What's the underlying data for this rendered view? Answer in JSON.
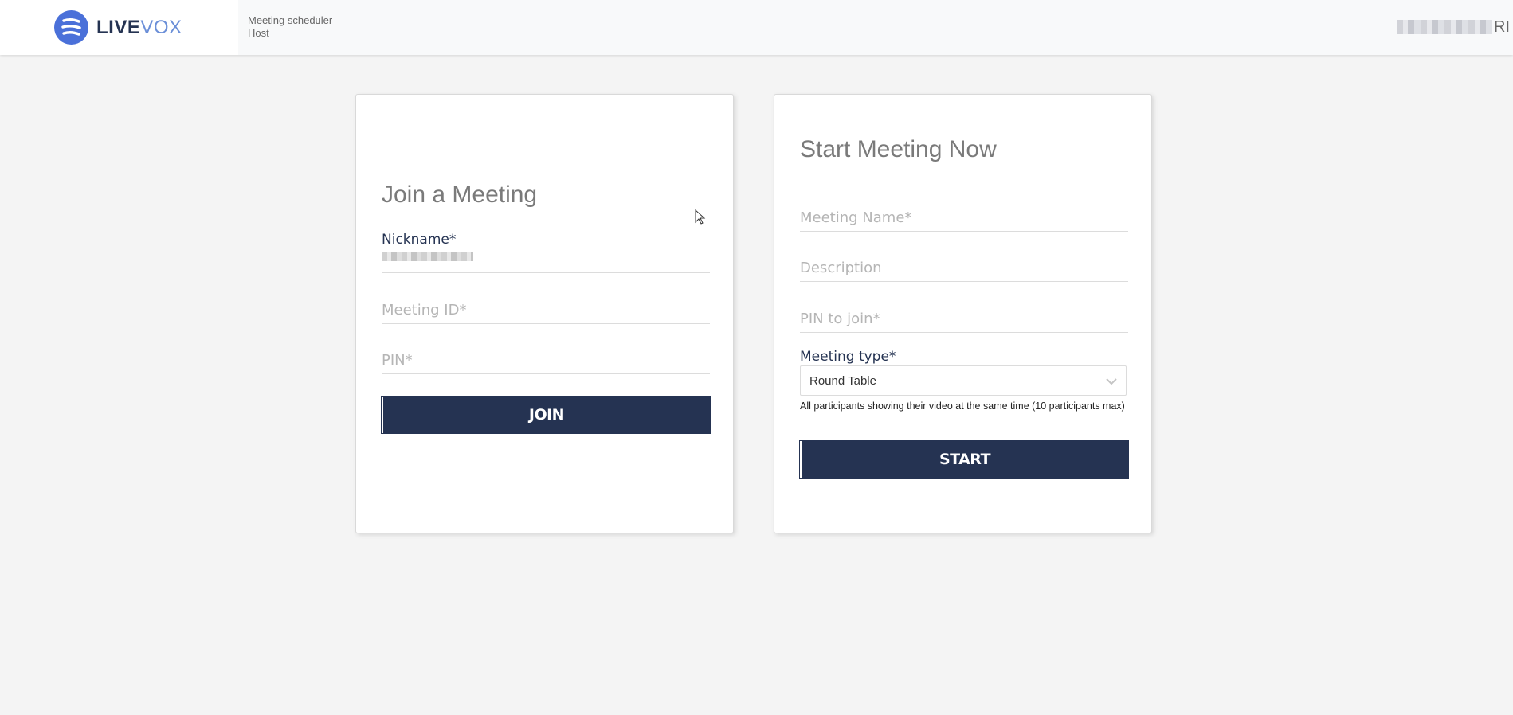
{
  "header": {
    "brand_primary": "LIVE",
    "brand_secondary": "VOX",
    "app_title": "Meeting scheduler",
    "app_role": "Host",
    "user_name_visible_suffix": "RI"
  },
  "join_card": {
    "title": "Join a Meeting",
    "nickname_label": "Nickname*",
    "nickname_value": "",
    "meeting_id_placeholder": "Meeting ID*",
    "pin_placeholder": "PIN*",
    "join_button": "JOIN"
  },
  "start_card": {
    "title": "Start Meeting Now",
    "meeting_name_placeholder": "Meeting Name*",
    "description_placeholder": "Description",
    "pin_placeholder": "PIN to join*",
    "meeting_type_label": "Meeting type*",
    "meeting_type_value": "Round Table",
    "meeting_type_help": "All participants showing their video at the same time (10 participants max)",
    "start_button": "START"
  },
  "colors": {
    "brand_dark": "#253352",
    "brand_blue": "#4a70d9",
    "background": "#f4f4f4"
  }
}
